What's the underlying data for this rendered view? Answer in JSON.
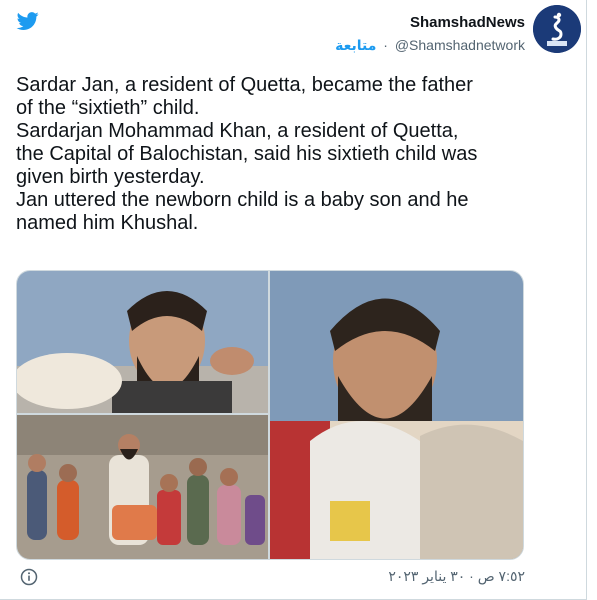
{
  "colors": {
    "accent": "#1d9bf0",
    "muted": "#536471",
    "text": "#0f1419",
    "avatar_bg": "#1b3a78"
  },
  "icons": {
    "brand": "twitter-bird-icon",
    "info": "info-icon"
  },
  "author": {
    "name": "ShamshadNews",
    "handle": "@Shamshadnetwork",
    "separator": "·",
    "follow_label": "متابعة"
  },
  "tweet": {
    "lines": [
      "Sardar Jan, a resident of Quetta, became the father",
      "of the “sixtieth” child.",
      "Sardarjan Mohammad Khan, a resident of Quetta,",
      "the Capital of Balochistan, said his sixtieth child was",
      "given birth yesterday.",
      "Jan uttered the newborn child is a baby son and he",
      "named him Khushal."
    ]
  },
  "timestamp": "٧:٥٢ ص · ٣٠ يناير ٢٠٢٣"
}
